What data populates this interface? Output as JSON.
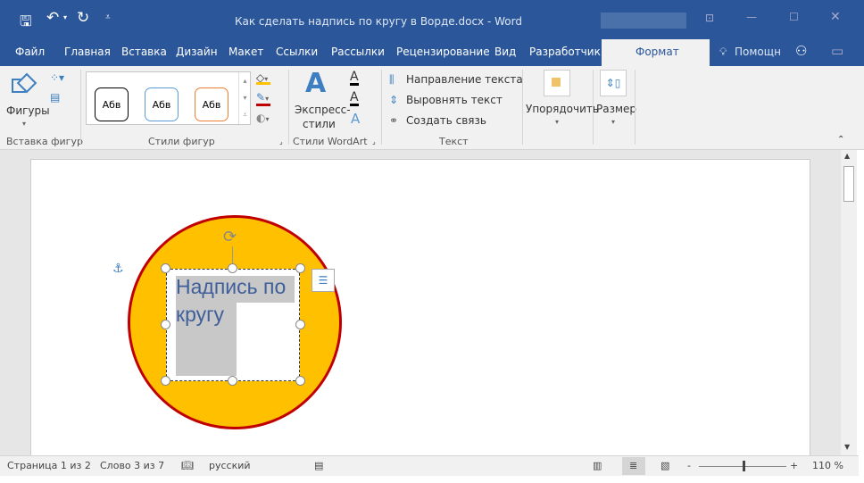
{
  "window": {
    "title": "Как сделать надпись по кругу в Ворде.docx - Word",
    "bg_color": "#2b579a"
  },
  "quick_access": {
    "save_icon": "save-icon",
    "undo_icon": "undo-icon",
    "redo_icon": "redo-icon",
    "customize_icon": "customize-icon"
  },
  "tabs": [
    {
      "label": "Файл"
    },
    {
      "label": "Главная"
    },
    {
      "label": "Вставка"
    },
    {
      "label": "Дизайн"
    },
    {
      "label": "Макет"
    },
    {
      "label": "Ссылки"
    },
    {
      "label": "Рассылки"
    },
    {
      "label": "Рецензирование"
    },
    {
      "label": "Вид"
    },
    {
      "label": "Разработчик"
    },
    {
      "label": "Формат",
      "active": true
    }
  ],
  "help": "Помощн",
  "ribbon": {
    "insert_shapes": {
      "shapes_label": "Фигуры",
      "group_label": "Вставка фигур"
    },
    "shape_styles": {
      "styles": [
        "Абв",
        "Абв",
        "Абв"
      ],
      "style_colors": [
        "#000000",
        "#5b9bd5",
        "#ed7d31"
      ],
      "group_label": "Стили фигур"
    },
    "wordart": {
      "express_label_1": "Экспресс-",
      "express_label_2": "стили",
      "group_label": "Стили WordArt"
    },
    "text": {
      "direction": "Направление текста",
      "align": "Выровнять текст",
      "link": "Создать связь",
      "group_label": "Текст"
    },
    "arrange": {
      "label": "Упорядочить"
    },
    "size": {
      "label": "Размер"
    }
  },
  "document": {
    "textbox_text_1": "Надпись по",
    "textbox_text_2": "кругу",
    "circle_fill": "#ffc000",
    "circle_border": "#c00000"
  },
  "status": {
    "page": "Страница 1 из 2",
    "words": "Слово 3 из 7",
    "language": "русский",
    "zoom": "110 %",
    "zoom_value": 110
  }
}
